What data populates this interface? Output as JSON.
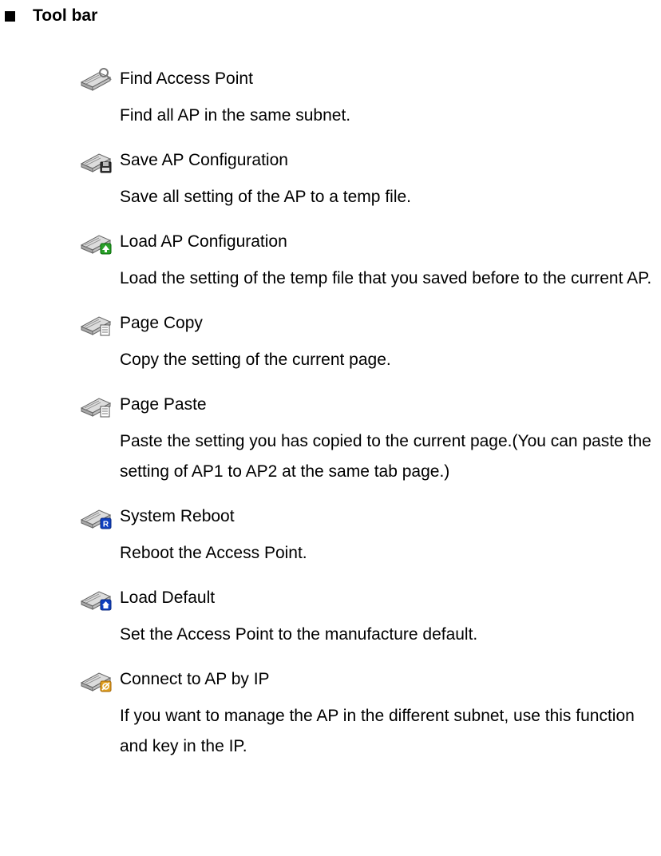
{
  "heading": "Tool bar",
  "items": [
    {
      "title": "Find Access Point",
      "description": "Find all AP in the same subnet.",
      "icon_name": "find-access-point-icon",
      "badge": "search",
      "badge_color": "#e8e8d0"
    },
    {
      "title": "Save AP Configuration",
      "description": "Save all setting of the AP to a temp file.",
      "icon_name": "save-ap-config-icon",
      "badge": "disk",
      "badge_color": "#333333"
    },
    {
      "title": "Load AP Configuration",
      "description": "Load the setting of the temp file that you saved before to the current AP.",
      "icon_name": "load-ap-config-icon",
      "badge": "up",
      "badge_color": "#2aa02a"
    },
    {
      "title": "Page Copy",
      "description": "Copy the setting of the current page.",
      "icon_name": "page-copy-icon",
      "badge": "doc",
      "badge_color": "#f0f0f0"
    },
    {
      "title": "Page Paste",
      "description": "Paste the setting you has copied to the current page.(You can paste the setting of AP1 to AP2 at the same tab page.)",
      "icon_name": "page-paste-icon",
      "badge": "doc",
      "badge_color": "#f0f0f0"
    },
    {
      "title": "System Reboot",
      "description": "Reboot the Access Point.",
      "icon_name": "system-reboot-icon",
      "badge": "R",
      "badge_color": "#1040c0"
    },
    {
      "title": "Load Default",
      "description": "Set the Access Point to the manufacture default.",
      "icon_name": "load-default-icon",
      "badge": "home",
      "badge_color": "#1040c0"
    },
    {
      "title": "Connect to AP by IP",
      "description": "If you want to manage the AP in the different subnet, use this function and key in the IP.",
      "icon_name": "connect-ap-ip-icon",
      "badge": "link",
      "badge_color": "#e0a020"
    }
  ]
}
